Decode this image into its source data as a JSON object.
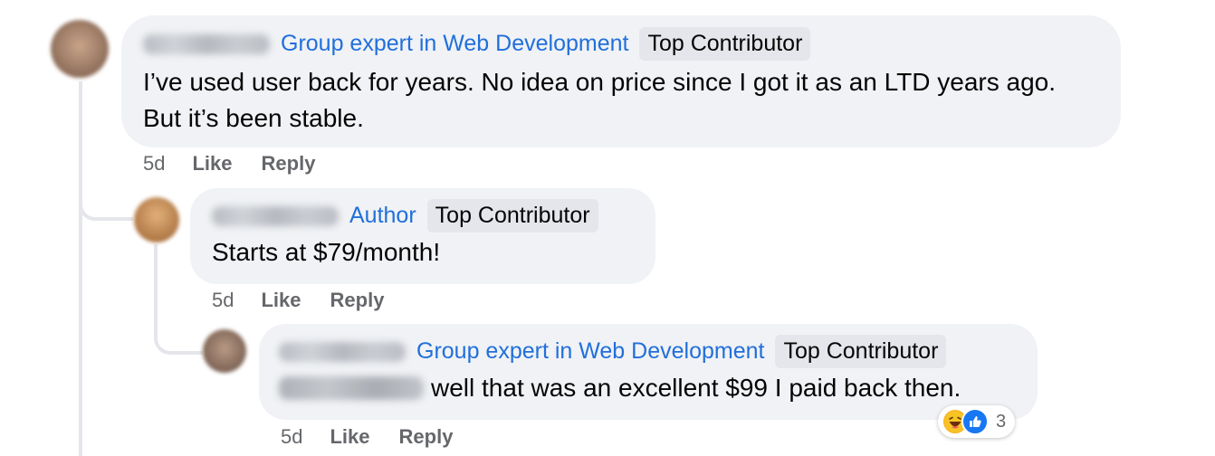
{
  "comments": [
    {
      "badge_group_expert": "Group expert in Web Development",
      "badge_top_contributor": "Top Contributor",
      "text": "I’ve used user back for years. No idea on price since I got it as an LTD years ago. But it’s been stable.",
      "timestamp": "5d",
      "like_label": "Like",
      "reply_label": "Reply"
    },
    {
      "badge_author": "Author",
      "badge_top_contributor": "Top Contributor",
      "text": "Starts at $79/month!",
      "timestamp": "5d",
      "like_label": "Like",
      "reply_label": "Reply"
    },
    {
      "badge_group_expert": "Group expert in Web Development",
      "badge_top_contributor": "Top Contributor",
      "text": "well that was an excellent $99 I paid back then.",
      "timestamp": "5d",
      "like_label": "Like",
      "reply_label": "Reply",
      "reactions": {
        "icons": [
          "haha-emoji-icon",
          "like-thumb-icon"
        ],
        "count": "3"
      }
    }
  ],
  "colors": {
    "bubble_bg": "#f0f2f5",
    "link_blue": "#216fdb",
    "meta_gray": "#65676b",
    "like_blue": "#1877f2"
  }
}
